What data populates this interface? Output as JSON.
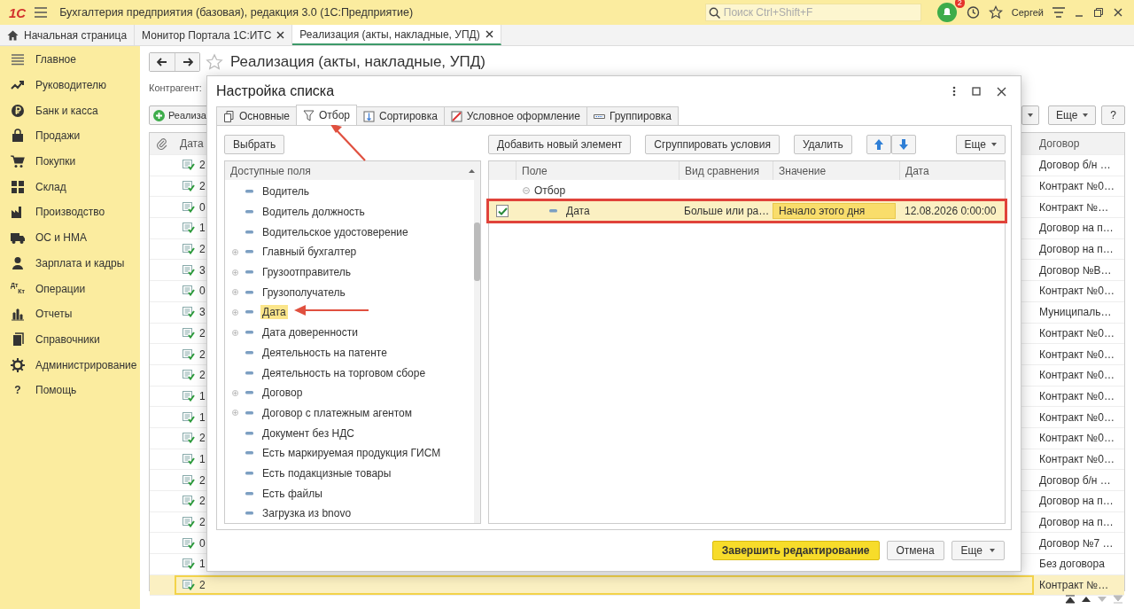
{
  "app": {
    "logo": "1С",
    "title": "Бухгалтерия предприятия (базовая), редакция 3.0  (1С:Предприятие)",
    "search_placeholder": "Поиск Ctrl+Shift+F",
    "notifications": "2",
    "user": "Сергей"
  },
  "open_tabs": [
    {
      "label": "Начальная страница",
      "closable": false,
      "selected": false
    },
    {
      "label": "Монитор Портала 1С:ИТС",
      "closable": true,
      "selected": false
    },
    {
      "label": "Реализация (акты, накладные, УПД)",
      "closable": true,
      "selected": true
    }
  ],
  "sidebar": {
    "items": [
      {
        "label": "Главное"
      },
      {
        "label": "Руководителю"
      },
      {
        "label": "Банк и касса"
      },
      {
        "label": "Продажи"
      },
      {
        "label": "Покупки"
      },
      {
        "label": "Склад"
      },
      {
        "label": "Производство"
      },
      {
        "label": "ОС и НМА"
      },
      {
        "label": "Зарплата и кадры"
      },
      {
        "label": "Операции",
        "icon_text": [
          "Дт",
          "Кт"
        ]
      },
      {
        "label": "Отчеты"
      },
      {
        "label": "Справочники"
      },
      {
        "label": "Администрирование"
      },
      {
        "label": "Помощь",
        "icon_text": [
          "?"
        ]
      }
    ]
  },
  "form": {
    "title": "Реализация (акты, накладные, УПД)",
    "counterparty_label": "Контрагент:",
    "create_button": "Реализа",
    "more_button": "Еще",
    "help_button": "?",
    "table": {
      "columns": [
        "Дата",
        "Договор"
      ],
      "rows": [
        {
          "date": "2",
          "contract": "Договор б/н …",
          "selected": false
        },
        {
          "date": "2",
          "contract": "Контракт №0…",
          "selected": false
        },
        {
          "date": "0",
          "contract": "Контракт №…",
          "selected": false
        },
        {
          "date": "1",
          "contract": "Договор на п…",
          "selected": false
        },
        {
          "date": "2",
          "contract": "Договор на п…",
          "selected": false
        },
        {
          "date": "3",
          "contract": "Договор №В…",
          "selected": false
        },
        {
          "date": "0",
          "contract": "Контракт №0…",
          "selected": false
        },
        {
          "date": "3",
          "contract": "Муниципаль…",
          "selected": false
        },
        {
          "date": "2",
          "contract": "Контракт №0…",
          "selected": false
        },
        {
          "date": "2",
          "contract": "Контракт №0…",
          "selected": false
        },
        {
          "date": "2",
          "contract": "Контракт №0…",
          "selected": false
        },
        {
          "date": "1",
          "contract": "Контракт №0…",
          "selected": false
        },
        {
          "date": "1",
          "contract": "Контракт №0…",
          "selected": false
        },
        {
          "date": "2",
          "contract": "Контракт №0…",
          "selected": false
        },
        {
          "date": "1",
          "contract": "Контракт №0…",
          "selected": false
        },
        {
          "date": "2",
          "contract": "Договор б/н …",
          "selected": false
        },
        {
          "date": "2",
          "contract": "Договор на п…",
          "selected": false
        },
        {
          "date": "2",
          "contract": "Договор на п…",
          "selected": false
        },
        {
          "date": "0",
          "contract": "Договор №7 …",
          "selected": false
        },
        {
          "date": "1",
          "contract": "Без договора",
          "selected": false
        },
        {
          "date": "2",
          "contract": "Контракт №…",
          "selected": true
        }
      ]
    }
  },
  "dialog": {
    "title": "Настройка списка",
    "tabs": [
      {
        "label": "Основные",
        "selected": false
      },
      {
        "label": "Отбор",
        "selected": true
      },
      {
        "label": "Сортировка",
        "selected": false
      },
      {
        "label": "Условное оформление",
        "selected": false
      },
      {
        "label": "Группировка",
        "selected": false
      }
    ],
    "select_button": "Выбрать",
    "fields_header": "Доступные поля",
    "fields": [
      {
        "label": "Водитель",
        "expandable": false,
        "selected": false
      },
      {
        "label": "Водитель должность",
        "expandable": false,
        "selected": false
      },
      {
        "label": "Водительское удостоверение",
        "expandable": false,
        "selected": false
      },
      {
        "label": "Главный бухгалтер",
        "expandable": true,
        "selected": false
      },
      {
        "label": "Грузоотправитель",
        "expandable": true,
        "selected": false
      },
      {
        "label": "Грузополучатель",
        "expandable": true,
        "selected": false
      },
      {
        "label": "Дата",
        "expandable": true,
        "selected": true
      },
      {
        "label": "Дата доверенности",
        "expandable": true,
        "selected": false
      },
      {
        "label": "Деятельность на патенте",
        "expandable": false,
        "selected": false
      },
      {
        "label": "Деятельность на торговом сборе",
        "expandable": false,
        "selected": false
      },
      {
        "label": "Договор",
        "expandable": true,
        "selected": false
      },
      {
        "label": "Договор с платежным агентом",
        "expandable": true,
        "selected": false
      },
      {
        "label": "Документ без НДС",
        "expandable": false,
        "selected": false
      },
      {
        "label": "Есть маркируемая продукция ГИСМ",
        "expandable": false,
        "selected": false
      },
      {
        "label": "Есть подакцизные товары",
        "expandable": false,
        "selected": false
      },
      {
        "label": "Есть файлы",
        "expandable": false,
        "selected": false
      },
      {
        "label": "Загрузка из bnovo",
        "expandable": false,
        "selected": false
      }
    ],
    "toolbar": {
      "add": "Добавить новый элемент",
      "group": "Сгруппировать условия",
      "delete": "Удалить",
      "more": "Еще"
    },
    "filter": {
      "columns": [
        "Поле",
        "Вид сравнения",
        "Значение",
        "Дата"
      ],
      "group": {
        "label": "Отбор",
        "expanded": true
      },
      "rows": [
        {
          "field": "Дата",
          "comparison": "Больше или ра…",
          "value": "Начало этого дня",
          "date": "12.08.2026 0:00:00",
          "checked": true,
          "outlined": true
        }
      ]
    },
    "footer": {
      "finish": "Завершить редактирование",
      "cancel": "Отмена",
      "more": "Еще"
    }
  }
}
